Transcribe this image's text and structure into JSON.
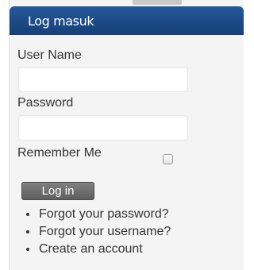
{
  "module": {
    "title": "Log masuk"
  },
  "form": {
    "username_label": "User Name",
    "username_value": "",
    "password_label": "Password",
    "password_value": "",
    "remember_label": "Remember Me",
    "remember_checked": false,
    "login_label": "Log in"
  },
  "links": [
    "Forgot your password?",
    "Forgot your username?",
    "Create an account"
  ],
  "colors": {
    "header": "#1c4d8a",
    "header_text": "#ffffff",
    "panel": "#f4f4f4",
    "button": "#6e6e6e"
  }
}
